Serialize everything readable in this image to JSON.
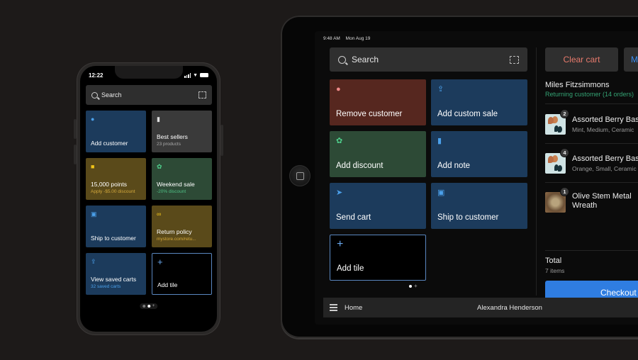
{
  "phone": {
    "status": {
      "time": "12:22"
    },
    "search": {
      "placeholder": "Search"
    },
    "tiles": [
      {
        "label": "Add customer",
        "sub": "",
        "icon": "person-icon"
      },
      {
        "label": "Best sellers",
        "sub": "23 products",
        "icon": "document-icon"
      },
      {
        "label": "15,000 points",
        "sub": "Apply -$5.00 discount",
        "icon": "points-icon"
      },
      {
        "label": "Weekend sale",
        "sub": "-20% discount",
        "icon": "discount-icon"
      },
      {
        "label": "Ship to customer",
        "sub": "",
        "icon": "truck-icon"
      },
      {
        "label": "Return policy",
        "sub": "mystore.com/retu...",
        "icon": "link-icon"
      },
      {
        "label": "View saved carts",
        "sub": "32 saved carts",
        "icon": "saved-cart-icon"
      },
      {
        "label": "Add tile",
        "sub": "",
        "icon": "plus-icon"
      }
    ]
  },
  "tablet": {
    "status": {
      "time": "9:48 AM",
      "date": "Mon Aug 19"
    },
    "search": {
      "placeholder": "Search"
    },
    "tiles": [
      {
        "label": "Remove customer",
        "icon": "person-icon"
      },
      {
        "label": "Add custom sale",
        "icon": "upload-icon"
      },
      {
        "label": "Add discount",
        "icon": "discount-icon"
      },
      {
        "label": "Add note",
        "icon": "note-icon"
      },
      {
        "label": "Send cart",
        "icon": "send-icon"
      },
      {
        "label": "Ship to customer",
        "icon": "truck-icon"
      },
      {
        "label": "Add tile",
        "icon": "plus-icon"
      }
    ],
    "bottom_bar": {
      "home_label": "Home",
      "user_name": "Alexandra Henderson"
    },
    "cart": {
      "clear_label": "Clear cart",
      "more_label": "M",
      "customer_name": "Miles Fitzsimmons",
      "customer_status": "Returning customer (14 orders)",
      "items": [
        {
          "qty": "2",
          "name": "Assorted Berry Bas",
          "variant": "Mint, Medium, Ceramic"
        },
        {
          "qty": "4",
          "name": "Assorted Berry Bas",
          "variant": "Orange, Small, Ceramic"
        },
        {
          "qty": "1",
          "name": "Olive Stem Metal Wreath",
          "variant": ""
        }
      ],
      "total_label": "Total",
      "total_items": "7 items",
      "checkout_label": "Checkout"
    }
  },
  "colors": {
    "accent_blue": "#2f7de1",
    "returning_green": "#34a374",
    "clear_red": "#e77a6c"
  }
}
